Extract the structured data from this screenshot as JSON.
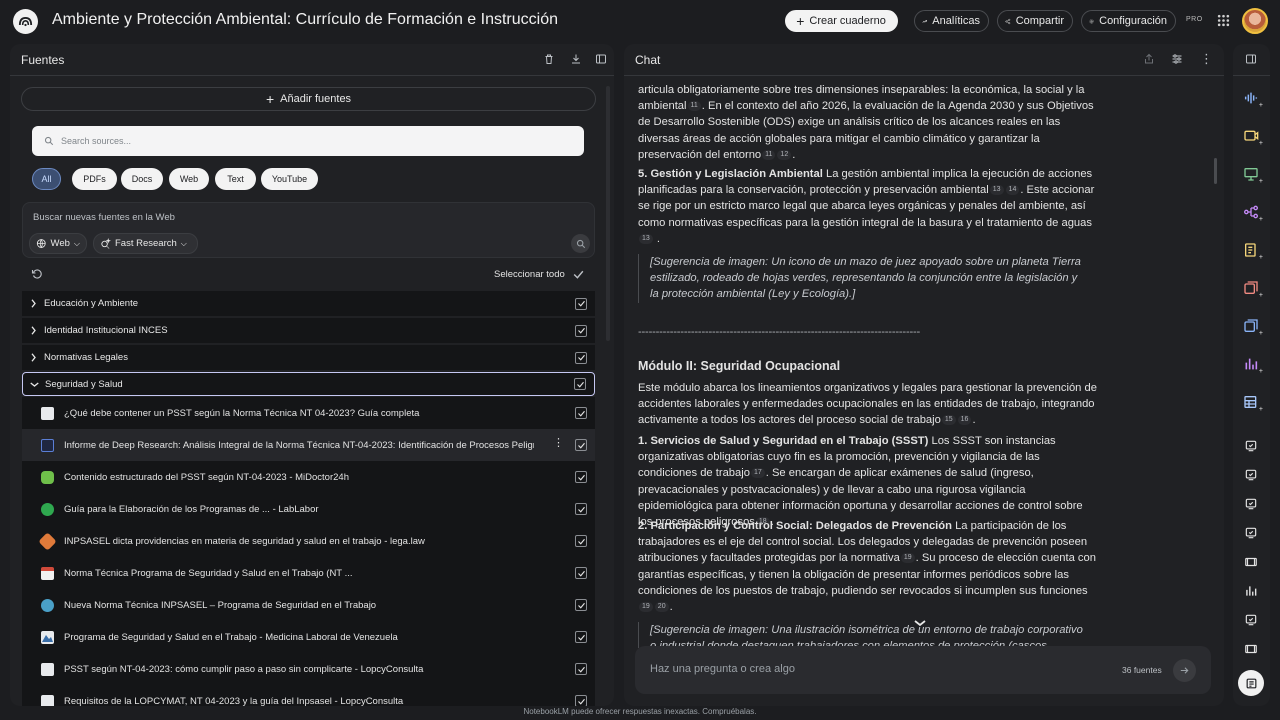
{
  "header": {
    "title": "Ambiente y Protección Ambiental: Currículo de Formación e Instrucción",
    "create_label": "Crear cuaderno",
    "analytics_label": "Analíticas",
    "share_label": "Compartir",
    "settings_label": "Configuración",
    "plan_badge": "PRO"
  },
  "sources": {
    "title": "Fuentes",
    "add_label": "Añadir fuentes",
    "search_placeholder": "Search sources...",
    "filters": [
      "All",
      "PDFs",
      "Docs",
      "Web",
      "Text",
      "YouTube"
    ],
    "active_filter": "All",
    "web_search_label": "Buscar nuevas fuentes en la Web",
    "web_dropdown": "Web",
    "research_dropdown": "Fast Research",
    "select_all_label": "Seleccionar todo",
    "folders": [
      {
        "label": "Educación y Ambiente",
        "open": false
      },
      {
        "label": "Identidad Institucional INCES",
        "open": false
      },
      {
        "label": "Normativas Legales",
        "open": false
      },
      {
        "label": "Seguridad y Salud",
        "open": true
      }
    ],
    "items": [
      {
        "label": "¿Qué debe contener un PSST según la Norma Técnica NT 04-2023? Guía completa",
        "favicon_color": "#e8eaed"
      },
      {
        "label": "Informe de Deep Research: Análisis Integral de la Norma Técnica NT-04-2023: Identificación de Procesos Peligr...",
        "favicon_color": "#5b7fd6"
      },
      {
        "label": "Contenido estructurado del PSST según NT-04-2023 - MiDoctor24h",
        "favicon_color": "#6fbf4a"
      },
      {
        "label": "Guía para la Elaboración de los Programas de ... - LabLabor",
        "favicon_color": "#2fa84f"
      },
      {
        "label": "INPSASEL dicta providencias en materia de seguridad y salud en el trabajo - lega.law",
        "favicon_color": "#e07a3a"
      },
      {
        "label": "Norma Técnica Programa de Seguridad y Salud en el Trabajo (NT ...",
        "favicon_color": "#d04a3a"
      },
      {
        "label": "Nueva Norma Técnica INPSASEL – Programa de Seguridad en el Trabajo",
        "favicon_color": "#4aa0c8"
      },
      {
        "label": "Programa de Seguridad y Salud en el Trabajo - Medicina Laboral de Venezuela",
        "favicon_color": "#3a6ea8"
      },
      {
        "label": "PSST según NT-04-2023: cómo cumplir paso a paso sin complicarte - LopcyConsulta",
        "favicon_color": "#e8eaed"
      },
      {
        "label": "Requisitos de la LOPCYMAT, NT 04-2023 y la guía del Inpsasel - LopcyConsulta",
        "favicon_color": "#e8eaed"
      }
    ]
  },
  "chat": {
    "title": "Chat",
    "p1_a": "articula obligatoriamente sobre tres dimensiones inseparables: la económica, la social y la ambiental",
    "p1_b": ". En el contexto del año 2026, la evaluación de la Agenda 2030 y sus Objetivos de Desarrollo Sostenible (ODS) exige un análisis crítico de los alcances reales en las diversas áreas de acción globales para mitigar el cambio climático y garantizar la preservación del entorno",
    "s5_title": "5. Gestión y Legislación Ambiental",
    "s5_a": " La gestión ambiental implica la ejecución de acciones planificadas para la conservación, protección y preservación ambiental",
    "s5_b": ". Este accionar se rige por un estricto marco legal que abarca leyes orgánicas y penales del ambiente, así como normativas específicas para la gestión integral de la basura y el tratamiento de aguas",
    "sugg1": "[Sugerencia de imagen: Un icono de un mazo de juez apoyado sobre un planeta Tierra estilizado, rodeado de hojas verdes, representando la conjunción entre la legislación y la protección ambiental (Ley y Ecología).]",
    "separator": "--------------------------------------------------------------------------------",
    "module_title": "Módulo II: Seguridad Ocupacional",
    "module_intro": "Este módulo abarca los lineamientos organizativos y legales para gestionar la prevención de accidentes laborales y enfermedades ocupacionales en las entidades de trabajo, integrando activamente a todos los actores del proceso social de trabajo",
    "s1_title": "1. Servicios de Salud y Seguridad en el Trabajo (SSST)",
    "s1_a": " Los SSST son instancias organizativas obligatorias cuyo fin es la promoción, prevención y vigilancia de las condiciones de trabajo",
    "s1_b": ". Se encargan de aplicar exámenes de salud (ingreso, prevacacionales y postvacacionales) y de llevar a cabo una rigurosa vigilancia epidemiológica para obtener información oportuna y desarrollar acciones de control sobre los procesos peligrosos",
    "s2_title": "2. Participación y Control Social: Delegados de Prevención",
    "s2_a": " La participación de los trabajadores es el eje del control social. Los delegados y delegadas de prevención poseen atribuciones y facultades protegidas por la normativa",
    "s2_b": ". Su proceso de elección cuenta con garantías específicas, y tienen la obligación de presentar informes periódicos sobre las condiciones de los puestos de trabajo, pudiendo ser revocados si incumplen sus funciones",
    "sugg2": "[Sugerencia de imagen: Una ilustración isométrica de un entorno de trabajo corporativo o industrial donde destaquen trabajadores con elementos de protección (cascos, chalecos)",
    "citations": [
      "11",
      "12",
      "13",
      "14",
      "15",
      "16",
      "17",
      "18",
      "19",
      "20"
    ],
    "input_placeholder": "Haz una pregunta o crea algo",
    "sources_count": "36 fuentes"
  },
  "footer": {
    "note": "NotebookLM puede ofrecer respuestas inexactas. Compruébalas."
  },
  "colors": {
    "background": "#1c1d20",
    "panel": "#202124",
    "active_chip": "#3c4f72",
    "selected_folder_border": "#c6c8f2"
  }
}
